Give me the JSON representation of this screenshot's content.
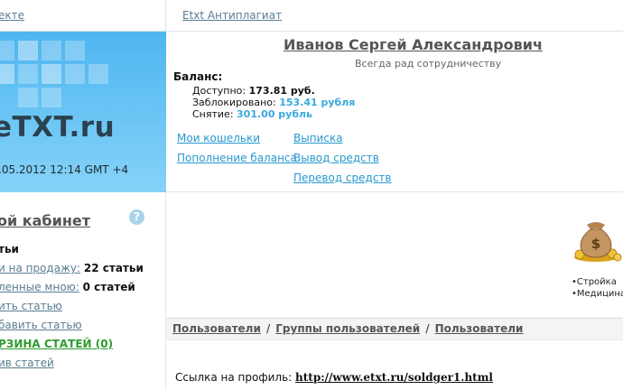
{
  "topbar": {
    "left_link": "екте",
    "antiplagiat": "Etxt Антиплагиат"
  },
  "logo": {
    "word": "eTXT",
    "dot": ".",
    "tld": "ru",
    "datetime": ".05.2012 12:14 GMT +4",
    "colors": {
      "panel": "#5dbdf2",
      "text": "#2a4150"
    }
  },
  "profile": {
    "name": "Иванов Сергей Александрович",
    "motto": "Всегда рад сотрудничеству",
    "balance": {
      "title": "Баланс:",
      "available_label": "Доступно:",
      "available_value": "173.81 руб.",
      "blocked_label": "Заблокировано:",
      "blocked_value": "153.41 рубля",
      "withdraw_label": "Снятие:",
      "withdraw_value": "301.00 рубль"
    },
    "links": {
      "wallets": "Мои кошельки",
      "topup": "Пополнение баланса",
      "statement": "Выписка",
      "withdrawal": "Вывод средств",
      "transfer": "Перевод средств"
    }
  },
  "sidebar": {
    "title": "ой кабинет",
    "help": "?",
    "section_head": "тьи",
    "items": [
      {
        "label": "и на продажу:",
        "count": "22 статьи"
      },
      {
        "label": "ленные мною:",
        "count": "0 статей"
      },
      {
        "label": "ить статью"
      },
      {
        "label": "бавить статью"
      },
      {
        "label": "РЗИНА СТАТЕЙ (0)",
        "accent": "#2d9b2d"
      },
      {
        "label": "ив статей"
      }
    ]
  },
  "promo": {
    "lines": [
      "•Стройка",
      "•Медицина"
    ],
    "icon": "money-bag-icon"
  },
  "breadcrumb": {
    "items": [
      "Пользователи",
      "Группы пользователей",
      "Пользователи"
    ],
    "separator": "/"
  },
  "profile_link": {
    "label": "Ссылка на профиль:",
    "url": "http://www.etxt.ru/soldger1.html"
  }
}
